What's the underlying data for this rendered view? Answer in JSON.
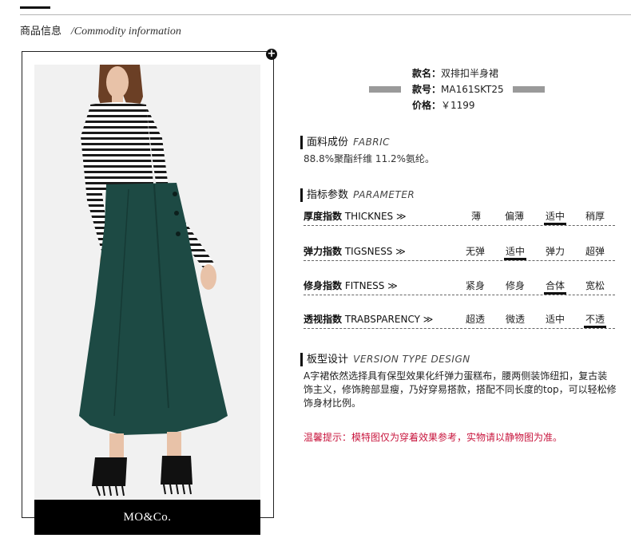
{
  "section": {
    "title_zh": "商品信息",
    "title_en": "/Commodity information"
  },
  "brand": "MO&Co.",
  "product": {
    "name_label": "款名：",
    "name_value": "双排扣半身裙",
    "code_label": "款号：",
    "code_value": "MA161SKT25",
    "price_label": "价格：",
    "price_value": "￥1199"
  },
  "fabric": {
    "title_zh": "面料成份",
    "title_en": "FABRIC",
    "text": "88.8%聚酯纤维 11.2%氨纶。"
  },
  "parameter": {
    "title_zh": "指标参数",
    "title_en": "PARAMETER",
    "rows": [
      {
        "label_zh": "厚度指数",
        "label_en": "THICKNES",
        "options": [
          "薄",
          "偏薄",
          "适中",
          "稍厚"
        ],
        "selected": 2
      },
      {
        "label_zh": "弹力指数",
        "label_en": "TIGSNESS",
        "options": [
          "无弹",
          "适中",
          "弹力",
          "超弹"
        ],
        "selected": 1
      },
      {
        "label_zh": "修身指数",
        "label_en": "FITNESS",
        "options": [
          "紧身",
          "修身",
          "合体",
          "宽松"
        ],
        "selected": 2
      },
      {
        "label_zh": "透视指数",
        "label_en": "TRABSPARENCY",
        "options": [
          "超透",
          "微透",
          "适中",
          "不透"
        ],
        "selected": 3
      }
    ]
  },
  "design": {
    "title_zh": "板型设计",
    "title_en": "VERSION TYPE DESIGN",
    "text": "A字裙依然选择具有保型效果化纤弹力蛋糕布，腰两侧装饰纽扣，复古装饰主义，修饰胯部显瘦，乃好穿易搭款，搭配不同长度的top，可以轻松修饰身材比例。"
  },
  "note": "温馨提示：模特图仅为穿着效果参考，实物请以静物图为准。",
  "icons": {
    "zoom": "plus-icon",
    "arrow": "double-chevron-right-icon"
  },
  "colors": {
    "note": "#c8163e",
    "skirt": "#1d4a44",
    "brand_bar": "#000000"
  }
}
